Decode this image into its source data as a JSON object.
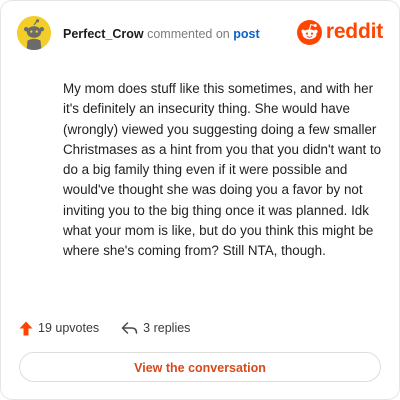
{
  "comment": {
    "author": "Perfect_Crow",
    "action_text": "commented on",
    "post_link_label": "post",
    "body": "My mom does stuff like this sometimes, and with her it's definitely an insecurity thing. She would have (wrongly) viewed you suggesting doing a few smaller Christmases as a hint from you that you didn't want to do a big family thing even if it were possible and would've thought she was doing you a favor by not inviting you to the big thing once it was planned. Idk what your mom is like, but do you think this might be where she's coming from? Still NTA, though."
  },
  "brand": {
    "name": "reddit",
    "color": "#ff4500"
  },
  "footer": {
    "upvotes_label": "19 upvotes",
    "replies_label": "3 replies"
  },
  "cta": {
    "label": "View the conversation"
  },
  "icons": {
    "avatar": "snoo-avatar",
    "logo": "reddit-logo-icon",
    "upvote": "upvote-arrow-icon",
    "reply": "reply-arrow-icon"
  },
  "colors": {
    "upvote": "#ff4500",
    "link": "#0a62c7",
    "cta_text": "#d64a1a",
    "avatar_bg": "#f3ce2a"
  }
}
